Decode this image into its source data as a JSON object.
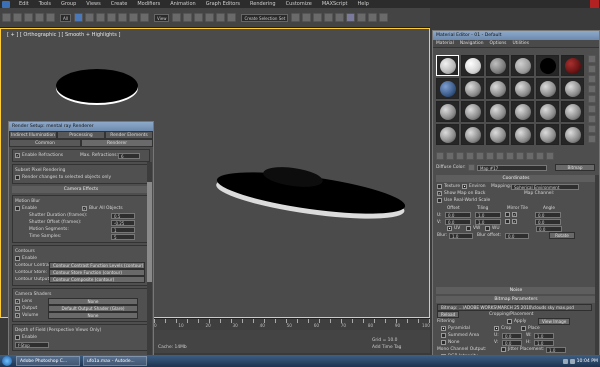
{
  "menubar": {
    "items": [
      "Edit",
      "Tools",
      "Group",
      "Views",
      "Create",
      "Modifiers",
      "Animation",
      "Graph Editors",
      "Rendering",
      "Customize",
      "MAXScript",
      "Help"
    ]
  },
  "toolbar": {
    "filter_dropdown": "All",
    "view_dropdown": "View",
    "selection_set": "Create Selection Set"
  },
  "viewport": {
    "label": "[ + ] [ Orthographic ] [ Smooth + Highlights ]"
  },
  "render_setup": {
    "title": "Render Setup: mental ray Renderer",
    "tabs_row1": [
      "Indirect Illumination",
      "Processing",
      "Render Elements"
    ],
    "tabs_row2": [
      "Common",
      "Renderer"
    ],
    "refraction_check": "Enable Refractions",
    "max_refractions_label": "Max. Refractions:",
    "max_refractions_value": "6",
    "subset_heading": "Subset Pixel Rendering",
    "subset_check": "Render changes to selected objects only",
    "camera_effects_head": "Camera Effects",
    "motion_blur_heading": "Motion Blur",
    "mb_enable": "Enable",
    "mb_blur_all": "Blur All Objects",
    "mb_fields": [
      {
        "label": "Shutter Duration (frames):",
        "value": "0.5"
      },
      {
        "label": "Shutter Offset (frames):",
        "value": "-0.25"
      },
      {
        "label": "Motion Segments:",
        "value": "1"
      },
      {
        "label": "Time Samples:",
        "value": "5"
      }
    ],
    "contours_heading": "Contours",
    "contours_enable": "Enable",
    "contours_rows": [
      {
        "label": "Contour Contrast:",
        "value": "Contour Contrast Function Levels (contour)"
      },
      {
        "label": "Contour Store:",
        "value": "Contour Store Function (contour)"
      },
      {
        "label": "Contour Output:",
        "value": "Contour Composite (contour)"
      }
    ],
    "shaders_heading": "Camera Shaders",
    "shader_rows": [
      {
        "label": "Lens",
        "value": "None"
      },
      {
        "label": "Output",
        "value": "Default Output Shader (Glare)"
      },
      {
        "label": "Volume",
        "value": "None"
      }
    ],
    "dof_heading": "Depth of Field (Perspective Views Only)",
    "dof_enable": "Enable",
    "dof_value": "f-Stop"
  },
  "material_editor": {
    "title": "Material Editor - 01 - Default",
    "menu": [
      "Material",
      "Navigation",
      "Options",
      "Utilities"
    ],
    "diffuse_label": "Diffuse Color:",
    "map_name": "Map #17",
    "map_type": "Bitmap",
    "coords_head": "Coordinates",
    "texture_radio": "Texture",
    "environ_radio": "Environ",
    "mapping_label": "Mapping:",
    "mapping_value": "Spherical Environment",
    "show_map_check": "Show Map on Back",
    "map_channel_label": "Map Channel:",
    "real_world_check": "Use Real-World Scale",
    "offset_label": "Offset",
    "tiling_label": "Tiling",
    "mirror_tile_label": "Mirror Tile",
    "angle_label": "Angle",
    "u_label": "U:",
    "v_label": "V:",
    "u_offset": "0.0",
    "v_offset": "0.0",
    "u_tiling": "1.0",
    "v_tiling": "1.0",
    "u_angle": "0.0",
    "v_angle": "0.0",
    "w_angle": "0.0",
    "uv_radio": "UV",
    "vw_radio": "VW",
    "wu_radio": "WU",
    "blur_label": "Blur:",
    "blur_value": "1.0",
    "blur_offset_label": "Blur offset:",
    "blur_offset_value": "0.0",
    "rotate_btn": "Rotate",
    "noise_head": "Noise",
    "bitmap_head": "Bitmap Parameters",
    "bitmap_path": "Bitmap: ...\\ADOBE WORKS\\MARCH 25 2010\\clouds sky max.psd",
    "reload_btn": "Reload",
    "cropping_heading": "Cropping/Placement",
    "apply_check": "Apply",
    "view_image_btn": "View Image",
    "filtering_heading": "Filtering",
    "filter_opts": [
      "Pyramidal",
      "Summed Area",
      "None"
    ],
    "crop_radio": "Crop",
    "place_radio": "Place",
    "crop_fields": [
      {
        "label": "U:",
        "value": "0.0"
      },
      {
        "label": "V:",
        "value": "0.0"
      }
    ],
    "crop_wh": [
      {
        "label": "W:",
        "value": "1.0"
      },
      {
        "label": "H:",
        "value": "1.0"
      }
    ],
    "jitter_check": "Jitter Placement:",
    "jitter_value": "1.0",
    "mono_heading": "Mono Channel Output:",
    "mono_opts": [
      "RGB Intensity",
      "Alpha"
    ],
    "alpha_heading": "Alpha Source"
  },
  "timeline": {
    "ticks": [
      "0",
      "10",
      "20",
      "30",
      "40",
      "50",
      "60",
      "70",
      "80",
      "90",
      "100"
    ]
  },
  "status": {
    "grid": "Grid = 10.0",
    "add_time_tag": "Add Time Tag",
    "cache": "Cache: 14Mb"
  },
  "taskbar": {
    "tasks": [
      "Adobe Photoshop C...",
      "ufo1a.max - Autode..."
    ],
    "clock": "10:04 PM"
  }
}
